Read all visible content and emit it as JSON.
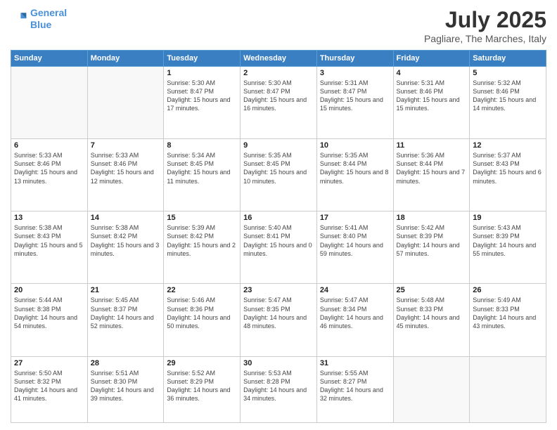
{
  "logo": {
    "line1": "General",
    "line2": "Blue"
  },
  "title": "July 2025",
  "location": "Pagliare, The Marches, Italy",
  "weekdays": [
    "Sunday",
    "Monday",
    "Tuesday",
    "Wednesday",
    "Thursday",
    "Friday",
    "Saturday"
  ],
  "weeks": [
    [
      {
        "day": "",
        "sunrise": "",
        "sunset": "",
        "daylight": ""
      },
      {
        "day": "",
        "sunrise": "",
        "sunset": "",
        "daylight": ""
      },
      {
        "day": "1",
        "sunrise": "Sunrise: 5:30 AM",
        "sunset": "Sunset: 8:47 PM",
        "daylight": "Daylight: 15 hours and 17 minutes."
      },
      {
        "day": "2",
        "sunrise": "Sunrise: 5:30 AM",
        "sunset": "Sunset: 8:47 PM",
        "daylight": "Daylight: 15 hours and 16 minutes."
      },
      {
        "day": "3",
        "sunrise": "Sunrise: 5:31 AM",
        "sunset": "Sunset: 8:47 PM",
        "daylight": "Daylight: 15 hours and 15 minutes."
      },
      {
        "day": "4",
        "sunrise": "Sunrise: 5:31 AM",
        "sunset": "Sunset: 8:46 PM",
        "daylight": "Daylight: 15 hours and 15 minutes."
      },
      {
        "day": "5",
        "sunrise": "Sunrise: 5:32 AM",
        "sunset": "Sunset: 8:46 PM",
        "daylight": "Daylight: 15 hours and 14 minutes."
      }
    ],
    [
      {
        "day": "6",
        "sunrise": "Sunrise: 5:33 AM",
        "sunset": "Sunset: 8:46 PM",
        "daylight": "Daylight: 15 hours and 13 minutes."
      },
      {
        "day": "7",
        "sunrise": "Sunrise: 5:33 AM",
        "sunset": "Sunset: 8:46 PM",
        "daylight": "Daylight: 15 hours and 12 minutes."
      },
      {
        "day": "8",
        "sunrise": "Sunrise: 5:34 AM",
        "sunset": "Sunset: 8:45 PM",
        "daylight": "Daylight: 15 hours and 11 minutes."
      },
      {
        "day": "9",
        "sunrise": "Sunrise: 5:35 AM",
        "sunset": "Sunset: 8:45 PM",
        "daylight": "Daylight: 15 hours and 10 minutes."
      },
      {
        "day": "10",
        "sunrise": "Sunrise: 5:35 AM",
        "sunset": "Sunset: 8:44 PM",
        "daylight": "Daylight: 15 hours and 8 minutes."
      },
      {
        "day": "11",
        "sunrise": "Sunrise: 5:36 AM",
        "sunset": "Sunset: 8:44 PM",
        "daylight": "Daylight: 15 hours and 7 minutes."
      },
      {
        "day": "12",
        "sunrise": "Sunrise: 5:37 AM",
        "sunset": "Sunset: 8:43 PM",
        "daylight": "Daylight: 15 hours and 6 minutes."
      }
    ],
    [
      {
        "day": "13",
        "sunrise": "Sunrise: 5:38 AM",
        "sunset": "Sunset: 8:43 PM",
        "daylight": "Daylight: 15 hours and 5 minutes."
      },
      {
        "day": "14",
        "sunrise": "Sunrise: 5:38 AM",
        "sunset": "Sunset: 8:42 PM",
        "daylight": "Daylight: 15 hours and 3 minutes."
      },
      {
        "day": "15",
        "sunrise": "Sunrise: 5:39 AM",
        "sunset": "Sunset: 8:42 PM",
        "daylight": "Daylight: 15 hours and 2 minutes."
      },
      {
        "day": "16",
        "sunrise": "Sunrise: 5:40 AM",
        "sunset": "Sunset: 8:41 PM",
        "daylight": "Daylight: 15 hours and 0 minutes."
      },
      {
        "day": "17",
        "sunrise": "Sunrise: 5:41 AM",
        "sunset": "Sunset: 8:40 PM",
        "daylight": "Daylight: 14 hours and 59 minutes."
      },
      {
        "day": "18",
        "sunrise": "Sunrise: 5:42 AM",
        "sunset": "Sunset: 8:39 PM",
        "daylight": "Daylight: 14 hours and 57 minutes."
      },
      {
        "day": "19",
        "sunrise": "Sunrise: 5:43 AM",
        "sunset": "Sunset: 8:39 PM",
        "daylight": "Daylight: 14 hours and 55 minutes."
      }
    ],
    [
      {
        "day": "20",
        "sunrise": "Sunrise: 5:44 AM",
        "sunset": "Sunset: 8:38 PM",
        "daylight": "Daylight: 14 hours and 54 minutes."
      },
      {
        "day": "21",
        "sunrise": "Sunrise: 5:45 AM",
        "sunset": "Sunset: 8:37 PM",
        "daylight": "Daylight: 14 hours and 52 minutes."
      },
      {
        "day": "22",
        "sunrise": "Sunrise: 5:46 AM",
        "sunset": "Sunset: 8:36 PM",
        "daylight": "Daylight: 14 hours and 50 minutes."
      },
      {
        "day": "23",
        "sunrise": "Sunrise: 5:47 AM",
        "sunset": "Sunset: 8:35 PM",
        "daylight": "Daylight: 14 hours and 48 minutes."
      },
      {
        "day": "24",
        "sunrise": "Sunrise: 5:47 AM",
        "sunset": "Sunset: 8:34 PM",
        "daylight": "Daylight: 14 hours and 46 minutes."
      },
      {
        "day": "25",
        "sunrise": "Sunrise: 5:48 AM",
        "sunset": "Sunset: 8:33 PM",
        "daylight": "Daylight: 14 hours and 45 minutes."
      },
      {
        "day": "26",
        "sunrise": "Sunrise: 5:49 AM",
        "sunset": "Sunset: 8:33 PM",
        "daylight": "Daylight: 14 hours and 43 minutes."
      }
    ],
    [
      {
        "day": "27",
        "sunrise": "Sunrise: 5:50 AM",
        "sunset": "Sunset: 8:32 PM",
        "daylight": "Daylight: 14 hours and 41 minutes."
      },
      {
        "day": "28",
        "sunrise": "Sunrise: 5:51 AM",
        "sunset": "Sunset: 8:30 PM",
        "daylight": "Daylight: 14 hours and 39 minutes."
      },
      {
        "day": "29",
        "sunrise": "Sunrise: 5:52 AM",
        "sunset": "Sunset: 8:29 PM",
        "daylight": "Daylight: 14 hours and 36 minutes."
      },
      {
        "day": "30",
        "sunrise": "Sunrise: 5:53 AM",
        "sunset": "Sunset: 8:28 PM",
        "daylight": "Daylight: 14 hours and 34 minutes."
      },
      {
        "day": "31",
        "sunrise": "Sunrise: 5:55 AM",
        "sunset": "Sunset: 8:27 PM",
        "daylight": "Daylight: 14 hours and 32 minutes."
      },
      {
        "day": "",
        "sunrise": "",
        "sunset": "",
        "daylight": ""
      },
      {
        "day": "",
        "sunrise": "",
        "sunset": "",
        "daylight": ""
      }
    ]
  ]
}
